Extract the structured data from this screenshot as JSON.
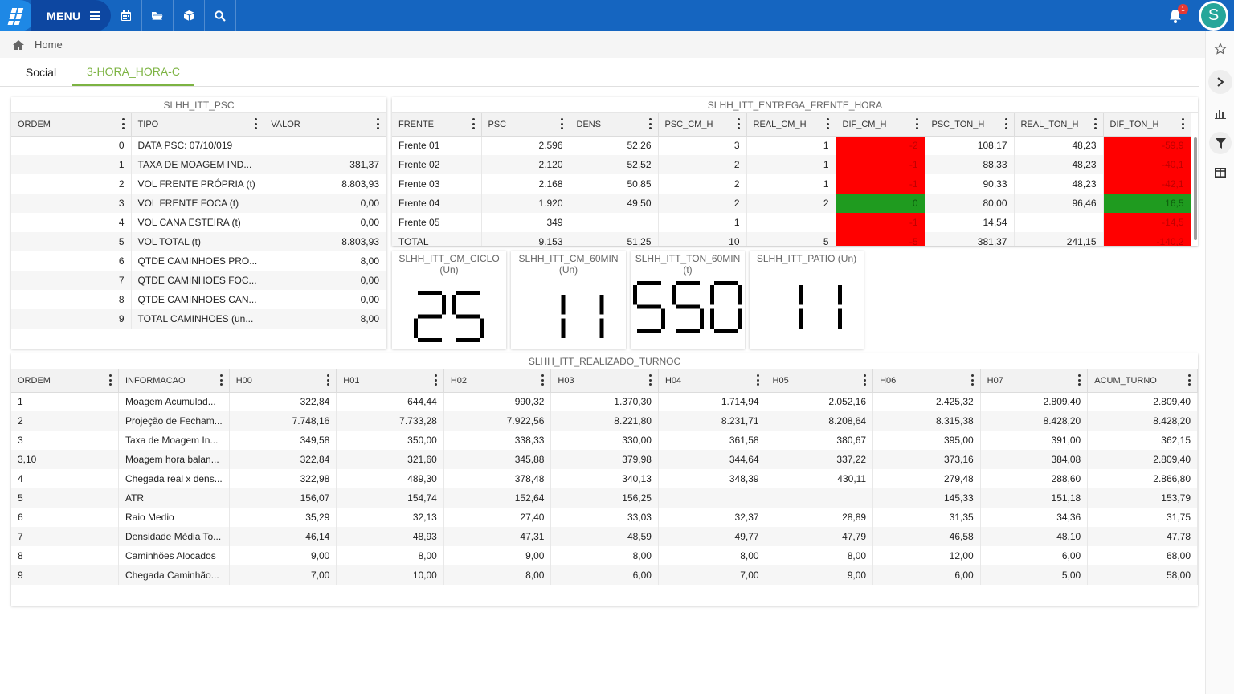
{
  "topbar": {
    "menu_label": "MENU",
    "icons": [
      "calendar-icon",
      "folder-icon",
      "cube-icon",
      "search-icon"
    ],
    "notification_count": "1",
    "avatar_letter": "S"
  },
  "breadcrumb": {
    "home": "Home"
  },
  "tabs": [
    {
      "label": "Social"
    },
    {
      "label": "3-HORA_HORA-C",
      "active": true
    }
  ],
  "colors": {
    "topbar": "#1565c0",
    "accent": "#7cb342",
    "negative": "#ff0000",
    "positive": "#1f9b1f"
  },
  "psc": {
    "title": "SLHH_ITT_PSC",
    "headers": [
      "ORDEM",
      "TIPO",
      "VALOR"
    ],
    "rows": [
      [
        "0",
        "DATA PSC: 07/10/019",
        ""
      ],
      [
        "1",
        "TAXA DE MOAGEM IND...",
        "381,37"
      ],
      [
        "2",
        "VOL FRENTE PRÓPRIA (t)",
        "8.803,93"
      ],
      [
        "3",
        "VOL FRENTE FOCA (t)",
        "0,00"
      ],
      [
        "4",
        "VOL CANA ESTEIRA (t)",
        "0,00"
      ],
      [
        "5",
        "VOL TOTAL (t)",
        "8.803,93"
      ],
      [
        "6",
        "QTDE CAMINHOES PRO...",
        "8,00"
      ],
      [
        "7",
        "QTDE CAMINHOES FOC...",
        "0,00"
      ],
      [
        "8",
        "QTDE CAMINHOES CAN...",
        "0,00"
      ],
      [
        "9",
        "TOTAL CAMINHOES (un...",
        "8,00"
      ]
    ]
  },
  "entrega": {
    "title": "SLHH_ITT_ENTREGA_FRENTE_HORA",
    "headers": [
      "FRENTE",
      "PSC",
      "DENS",
      "PSC_CM_H",
      "REAL_CM_H",
      "DIF_CM_H",
      "PSC_TON_H",
      "REAL_TON_H",
      "DIF_TON_H"
    ],
    "rows": [
      [
        "Frente 01",
        "2.596",
        "52,26",
        "3",
        "1",
        "-2",
        "108,17",
        "48,23",
        "-59,9"
      ],
      [
        "Frente 02",
        "2.120",
        "52,52",
        "2",
        "1",
        "-1",
        "88,33",
        "48,23",
        "-40,1"
      ],
      [
        "Frente 03",
        "2.168",
        "50,85",
        "2",
        "1",
        "-1",
        "90,33",
        "48,23",
        "-42,1"
      ],
      [
        "Frente 04",
        "1.920",
        "49,50",
        "2",
        "2",
        "0",
        "80,00",
        "96,46",
        "16,5"
      ],
      [
        "Frente 05",
        "349",
        "",
        "1",
        "",
        "-1",
        "14,54",
        "",
        "-14,5"
      ],
      [
        "TOTAL",
        "9.153",
        "51,25",
        "10",
        "5",
        "-5",
        "381,37",
        "241,15",
        "-140,2"
      ]
    ],
    "dif_status": [
      [
        "red",
        "red"
      ],
      [
        "red",
        "red"
      ],
      [
        "red",
        "red"
      ],
      [
        "green",
        "green"
      ],
      [
        "red",
        "red"
      ],
      [
        "red",
        "red"
      ]
    ]
  },
  "gauges": [
    {
      "title": "SLHH_ITT_CM_CICLO",
      "unit": "(Un)",
      "value": "25"
    },
    {
      "title": "SLHH_ITT_CM_60MIN",
      "unit": "(Un)",
      "value": "11"
    },
    {
      "title": "SLHH_ITT_TON_60MIN",
      "unit": "(t)",
      "value": "550"
    },
    {
      "title": "SLHH_ITT_PATIO",
      "unit": "(Un)",
      "value": "11"
    }
  ],
  "realizado": {
    "title": "SLHH_ITT_REALIZADO_TURNOC",
    "headers": [
      "ORDEM",
      "INFORMACAO",
      "H00",
      "H01",
      "H02",
      "H03",
      "H04",
      "H05",
      "H06",
      "H07",
      "ACUM_TURNO"
    ],
    "rows": [
      [
        "1",
        "Moagem Acumulad...",
        "322,84",
        "644,44",
        "990,32",
        "1.370,30",
        "1.714,94",
        "2.052,16",
        "2.425,32",
        "2.809,40",
        "2.809,40"
      ],
      [
        "2",
        "Projeção de Fecham...",
        "7.748,16",
        "7.733,28",
        "7.922,56",
        "8.221,80",
        "8.231,71",
        "8.208,64",
        "8.315,38",
        "8.428,20",
        "8.428,20"
      ],
      [
        "3",
        "Taxa de Moagem In...",
        "349,58",
        "350,00",
        "338,33",
        "330,00",
        "361,58",
        "380,67",
        "395,00",
        "391,00",
        "362,15"
      ],
      [
        "3,10",
        "Moagem hora balan...",
        "322,84",
        "321,60",
        "345,88",
        "379,98",
        "344,64",
        "337,22",
        "373,16",
        "384,08",
        "2.809,40"
      ],
      [
        "4",
        "Chegada real x dens...",
        "322,98",
        "489,30",
        "378,48",
        "340,13",
        "348,39",
        "430,11",
        "279,48",
        "288,60",
        "2.866,80"
      ],
      [
        "5",
        "ATR",
        "156,07",
        "154,74",
        "152,64",
        "156,25",
        "",
        "",
        "145,33",
        "151,18",
        "153,79"
      ],
      [
        "6",
        "Raio Medio",
        "35,29",
        "32,13",
        "27,40",
        "33,03",
        "32,37",
        "28,89",
        "31,35",
        "34,36",
        "31,75"
      ],
      [
        "7",
        "Densidade Média To...",
        "46,14",
        "48,93",
        "47,31",
        "48,59",
        "49,77",
        "47,79",
        "46,58",
        "48,10",
        "47,78"
      ],
      [
        "8",
        "Caminhões Alocados",
        "9,00",
        "8,00",
        "9,00",
        "8,00",
        "8,00",
        "8,00",
        "12,00",
        "6,00",
        "68,00"
      ],
      [
        "9",
        "Chegada Caminhão...",
        "7,00",
        "10,00",
        "8,00",
        "6,00",
        "7,00",
        "9,00",
        "6,00",
        "5,00",
        "58,00"
      ]
    ]
  }
}
